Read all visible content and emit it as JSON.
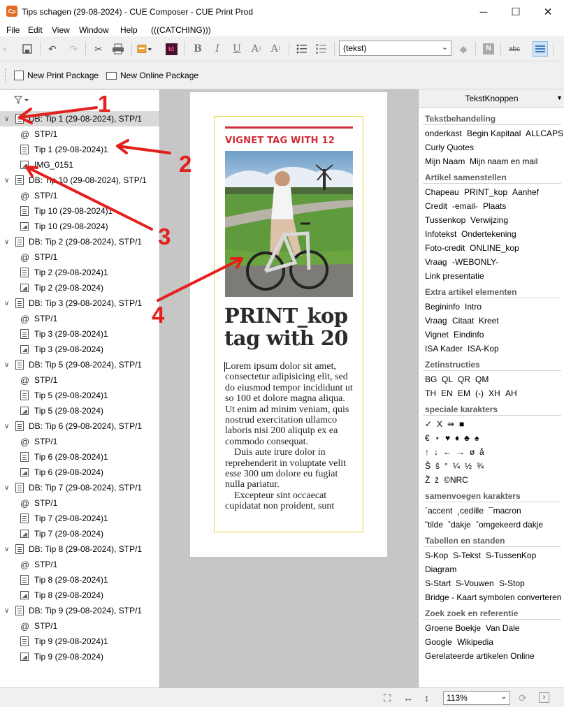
{
  "window": {
    "title": "Tips schagen (29-08-2024) - CUE Composer - CUE Print Prod",
    "app_icon": "Cp"
  },
  "menu": [
    "File",
    "Edit",
    "View",
    "Window",
    "Help",
    "(((CATCHING)))"
  ],
  "toolbar": {
    "style_value": "(tekst)",
    "bold": "B",
    "italic": "I",
    "underline": "U",
    "sub": "A",
    "sup": "A",
    "indesign": "Id",
    "spell": "abc",
    "n": "N"
  },
  "packages": {
    "print": "New Print Package",
    "online": "New Online Package"
  },
  "tree": [
    {
      "db": "DB: Tip 1 (29-08-2024), STP/1",
      "children": [
        "STP/1",
        "Tip 1 (29-08-2024)1",
        "IMG_0151"
      ]
    },
    {
      "db": "DB: Tip 10 (29-08-2024), STP/1",
      "children": [
        "STP/1",
        "Tip 10 (29-08-2024)1",
        "Tip 10 (29-08-2024)"
      ]
    },
    {
      "db": "DB: Tip 2 (29-08-2024), STP/1",
      "children": [
        "STP/1",
        "Tip 2 (29-08-2024)1",
        "Tip 2 (29-08-2024)"
      ]
    },
    {
      "db": "DB: Tip 3 (29-08-2024), STP/1",
      "children": [
        "STP/1",
        "Tip 3 (29-08-2024)1",
        "Tip 3 (29-08-2024)"
      ]
    },
    {
      "db": "DB: Tip 5 (29-08-2024), STP/1",
      "children": [
        "STP/1",
        "Tip 5 (29-08-2024)1",
        "Tip 5 (29-08-2024)"
      ]
    },
    {
      "db": "DB: Tip 6 (29-08-2024), STP/1",
      "children": [
        "STP/1",
        "Tip 6 (29-08-2024)1",
        "Tip 6 (29-08-2024)"
      ]
    },
    {
      "db": "DB: Tip 7 (29-08-2024), STP/1",
      "children": [
        "STP/1",
        "Tip 7 (29-08-2024)1",
        "Tip 7 (29-08-2024)"
      ]
    },
    {
      "db": "DB: Tip 8 (29-08-2024), STP/1",
      "children": [
        "STP/1",
        "Tip 8 (29-08-2024)1",
        "Tip 8 (29-08-2024)"
      ]
    },
    {
      "db": "DB: Tip 9 (29-08-2024), STP/1",
      "children": [
        "STP/1",
        "Tip 9 (29-08-2024)1",
        "Tip 9 (29-08-2024)"
      ]
    }
  ],
  "article": {
    "vignet": "VIGNET TAG WITH 12",
    "headline_1": "PRINT_kop",
    "headline_2": "tag with 20",
    "para1": "Lorem ipsum dolor sit amet, consectetur adipisicing elit, sed do eiusmod tempor incididunt ut so 100 et dolore magna aliqua. Ut enim ad minim veniam, quis nostrud exercitation ullamco laboris nisi 200 aliquip ex ea commodo consequat.",
    "para2": "Duis aute irure dolor in reprehenderit in voluptate velit esse 300 um dolore eu fugiat nulla pariatur.",
    "para3": "Excepteur sint occaecat cupidatat non proident, sunt"
  },
  "panel": {
    "title": "TekstKnoppen",
    "sections": [
      {
        "title": "Tekstbehandeling",
        "rows": [
          [
            "onderkast",
            "Begin Kapitaal",
            "ALLCAPS"
          ],
          [
            "Curly Quotes"
          ],
          [
            "Mijn Naam",
            "Mijn naam en mail"
          ]
        ]
      },
      {
        "title": "Artikel samenstellen",
        "rows": [
          [
            "Chapeau",
            "PRINT_kop",
            "Aanhef"
          ],
          [
            "Credit",
            "-email-",
            "Plaats"
          ],
          [
            "Tussenkop",
            "Verwijzing"
          ],
          [
            "Infotekst",
            "Ondertekening"
          ],
          [
            "Foto-credit",
            "ONLINE_kop"
          ],
          [
            "Vraag",
            "-WEBONLY-"
          ],
          [
            "Link presentatie"
          ]
        ]
      },
      {
        "title": "Extra artikel  elementen",
        "rows": [
          [
            "Begininfo",
            "Intro"
          ],
          [
            "Vraag",
            "Citaat",
            "Kreet"
          ],
          [
            "Vignet",
            "Eindinfo"
          ],
          [
            "ISA Kader",
            "ISA-Kop"
          ]
        ]
      },
      {
        "title": "Zetinstructies",
        "rows": [
          [
            "BG",
            "QL",
            "QR",
            "QM"
          ],
          [
            "TH",
            "EN",
            "EM",
            "(-)",
            "XH",
            "AH"
          ]
        ]
      },
      {
        "title": "speciale karakters",
        "rows": [
          [
            "✓",
            "X",
            "⇛",
            "■"
          ],
          [
            "€",
            "⋆",
            "♥",
            "♦",
            "♣",
            "♠"
          ],
          [
            "↑",
            "↓",
            "←",
            "→",
            "ø",
            "å"
          ],
          [
            "Š",
            "š",
            "°",
            "¼",
            "½",
            "¾"
          ],
          [
            "Ž",
            "ž",
            "©NRC"
          ]
        ]
      },
      {
        "title": "samenvoegen karakters",
        "rows": [
          [
            "´accent",
            "¸cedille",
            "¯macron"
          ],
          [
            "˜tilde",
            "ˆdakje",
            "ˇomgekeerd dakje"
          ]
        ]
      },
      {
        "title": "Tabellen en standen",
        "rows": [
          [
            "S-Kop",
            "S-Tekst",
            "S-TussenKop"
          ],
          [
            "Diagram"
          ],
          [
            "S-Start",
            "S-Vouwen",
            "S-Stop"
          ],
          [
            "Bridge - Kaart symbolen converteren"
          ]
        ]
      },
      {
        "title": "Zoek zoek en referentie",
        "rows": [
          [
            "Groene Boekje",
            "Van Dale"
          ],
          [
            "Google",
            "Wikipedia"
          ],
          [
            "Gerelateerde artikelen Online"
          ]
        ]
      }
    ]
  },
  "status": {
    "zoom": "113%"
  },
  "annotations": [
    "1",
    "2",
    "3",
    "4"
  ],
  "colors": {
    "annotation": "#e3201b",
    "vignet": "#d22b3a",
    "frame": "#e4d83d"
  }
}
